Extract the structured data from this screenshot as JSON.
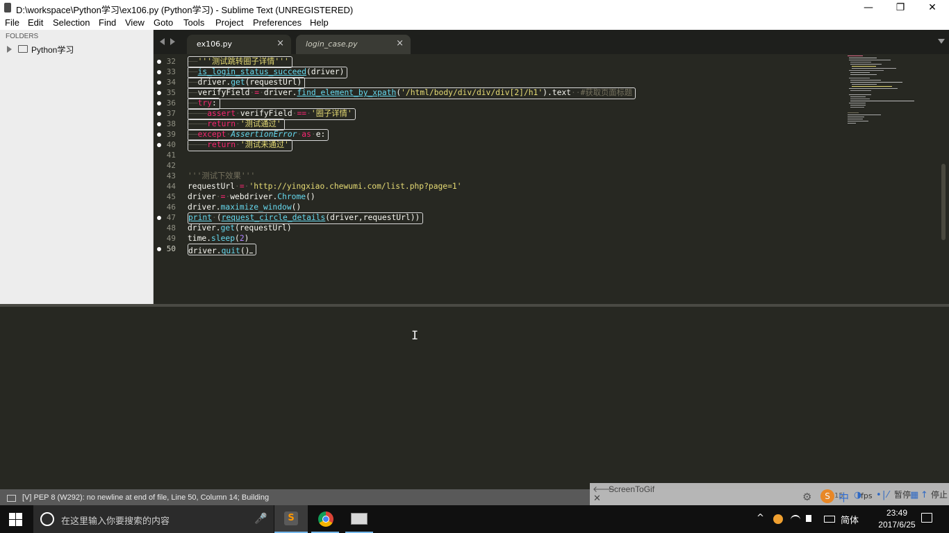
{
  "window": {
    "title": "D:\\workspace\\Python学习\\ex106.py (Python学习) - Sublime Text (UNREGISTERED)",
    "minimize": "—",
    "maximize": "❐",
    "close": "✕"
  },
  "menu": [
    "File",
    "Edit",
    "Selection",
    "Find",
    "View",
    "Goto",
    "Tools",
    "Project",
    "Preferences",
    "Help"
  ],
  "sidebar": {
    "header": "FOLDERS",
    "folders": [
      {
        "name": "Python学习",
        "icon": "folder-icon",
        "expanded": false
      }
    ]
  },
  "tabs": [
    {
      "label": "ex106.py",
      "active": true,
      "close": "×"
    },
    {
      "label": "login_case.py",
      "active": false,
      "close": "×"
    }
  ],
  "editor": {
    "lines": [
      {
        "num": "32",
        "marker": true,
        "boxed": true
      },
      {
        "num": "33",
        "marker": true,
        "boxed": true
      },
      {
        "num": "34",
        "marker": true,
        "boxed": true
      },
      {
        "num": "35",
        "marker": true,
        "boxed": true
      },
      {
        "num": "36",
        "marker": true,
        "boxed": true
      },
      {
        "num": "37",
        "marker": true,
        "boxed": true
      },
      {
        "num": "38",
        "marker": true,
        "boxed": true
      },
      {
        "num": "39",
        "marker": true,
        "boxed": true
      },
      {
        "num": "40",
        "marker": true,
        "boxed": true
      },
      {
        "num": "41",
        "marker": false,
        "boxed": false
      },
      {
        "num": "42",
        "marker": false,
        "boxed": false
      },
      {
        "num": "43",
        "marker": false,
        "boxed": false
      },
      {
        "num": "44",
        "marker": false,
        "boxed": false
      },
      {
        "num": "45",
        "marker": false,
        "boxed": false
      },
      {
        "num": "46",
        "marker": false,
        "boxed": false
      },
      {
        "num": "47",
        "marker": true,
        "boxed": true
      },
      {
        "num": "48",
        "marker": false,
        "boxed": false
      },
      {
        "num": "49",
        "marker": false,
        "boxed": false
      },
      {
        "num": "50",
        "marker": true,
        "boxed": true,
        "current": true
      }
    ],
    "code": {
      "l32_indent": "——",
      "l32_str": "'''测试跳转圈子详情'''",
      "l33_indent": "——",
      "l33_fn": "is_login_status_succeed",
      "l33_rest": "(driver)",
      "l34_indent": "——",
      "l34_a": "driver.",
      "l34_fn": "get",
      "l34_b": "(requestUrl)",
      "l35_indent": "——",
      "l35_a": "verifyField",
      "l35_ws1": "·",
      "l35_op": "=",
      "l35_ws2": "·",
      "l35_b": "driver.",
      "l35_fn": "find_element_by_xpath",
      "l35_c": "(",
      "l35_str": "'/html/body/div/div/div[2]/h1'",
      "l35_d": ").text",
      "l35_ws3": "··",
      "l35_com": "#获取页面标题",
      "l36_indent": "——",
      "l36_kw": "try",
      "l36_rest": ":",
      "l37_indent": "————",
      "l37_kw": "assert",
      "l37_ws1": "·",
      "l37_a": "verifyField",
      "l37_ws2": "·",
      "l37_op": "==",
      "l37_ws3": "·",
      "l37_str": "'圈子详情'",
      "l38_indent": "————",
      "l38_kw": "return",
      "l38_ws": "·",
      "l38_str": "'测试通过'",
      "l39_indent": "——",
      "l39_kw": "except",
      "l39_ws1": "·",
      "l39_cls": "AssertionError",
      "l39_ws2": "·",
      "l39_kw2": "as",
      "l39_ws3": "·",
      "l39_rest": "e:",
      "l40_indent": "————",
      "l40_kw": "return",
      "l40_ws": "·",
      "l40_str": "'测试未通过'",
      "l43_str": "'''测试下效果'''",
      "l44_a": "requestUrl",
      "l44_ws1": "·",
      "l44_op": "=",
      "l44_ws2": "·",
      "l44_str": "'http://yingxiao.chewumi.com/list.php?page=1'",
      "l45_a": "driver",
      "l45_ws1": "·",
      "l45_op": "=",
      "l45_ws2": "·",
      "l45_b": "webdriver.",
      "l45_fn": "Chrome",
      "l45_c": "()",
      "l46_a": "driver.",
      "l46_fn": "maximize_window",
      "l46_b": "()",
      "l47_fn": "print",
      "l47_ws": "·",
      "l47_a": "(",
      "l47_fn2": "request_circle_details",
      "l47_b": "(driver,requestUrl))",
      "l48_a": "driver.",
      "l48_fn": "get",
      "l48_b": "(requestUrl)",
      "l49_a": "time.",
      "l49_fn": "sleep",
      "l49_b": "(",
      "l49_num": "2",
      "l49_c": ")",
      "l50_a": "driver.",
      "l50_fn": "quit",
      "l50_b": "()"
    }
  },
  "status_bar": {
    "text": "[V] PEP 8 (W292): no newline at end of file, Line 50, Column 14; Building"
  },
  "screentogif": {
    "back": "🡐",
    "title": "ScreenToGif",
    "close": "✕",
    "gear": "⚙",
    "ime_logo": "S",
    "ime_lang": "中",
    "fps_prefix": "15",
    "fps": "fps",
    "pause": "暂停",
    "stop": "停止",
    "icon_moon": "◑",
    "icon_dot": "•",
    "icon_bar": "|",
    "icon_slash": "⁄",
    "icon_grid": "▦",
    "icon_up": "↑"
  },
  "taskbar": {
    "search_placeholder": "在这里输入你要搜索的内容",
    "mic": "🎤",
    "apps": [
      {
        "name": "sublime-text",
        "letter": "S",
        "active": true
      },
      {
        "name": "chrome",
        "active": false
      },
      {
        "name": "screentogif",
        "active": false
      }
    ],
    "tray": {
      "chevron": "^",
      "ime": "简体"
    },
    "clock_time": "23:49",
    "clock_date": "2017/6/25"
  },
  "colors": {
    "editor_bg": "#272822",
    "string": "#e6db74",
    "keyword": "#f92672",
    "function": "#66d9ef",
    "comment": "#75715e"
  }
}
